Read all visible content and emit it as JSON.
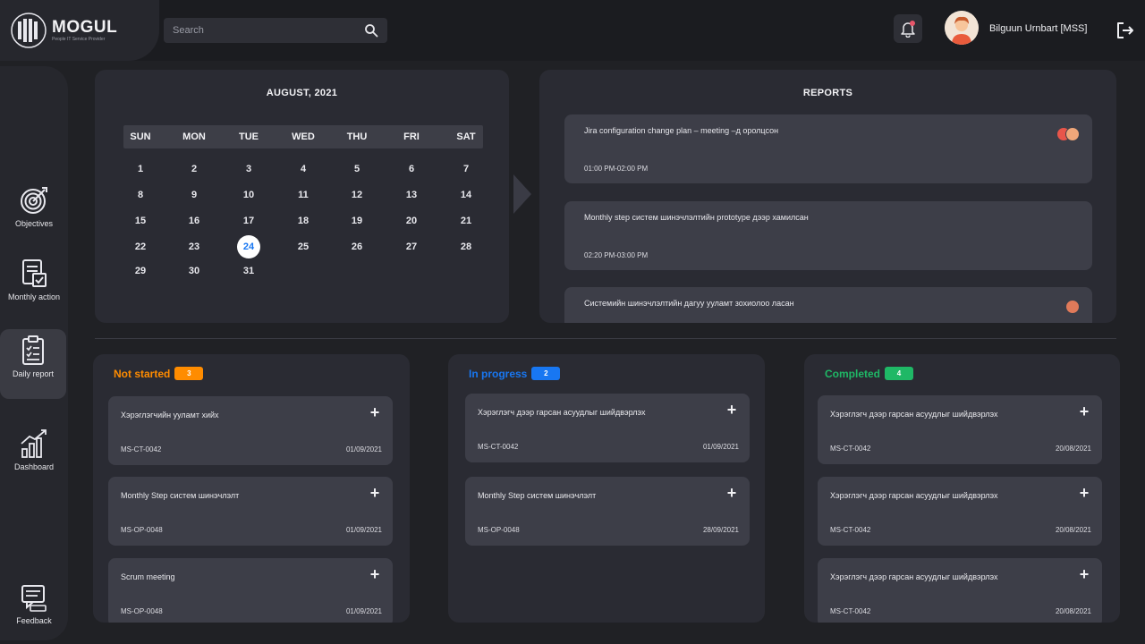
{
  "header": {
    "logo_name": "MOGUL",
    "logo_tagline": "People IT Service Provider",
    "search_placeholder": "Search",
    "user_name": "Bilguun Urnbart [MSS]"
  },
  "sidebar": {
    "items": [
      {
        "label": "Objectives",
        "icon": "target-icon"
      },
      {
        "label": "Monthly action",
        "icon": "document-icon"
      },
      {
        "label": "Daily report",
        "icon": "clipboard-icon",
        "active": true
      },
      {
        "label": "Dashboard",
        "icon": "chart-icon"
      },
      {
        "label": "Feedback",
        "icon": "feedback-icon"
      }
    ]
  },
  "calendar": {
    "title": "AUGUST, 2021",
    "weekdays": [
      "SUN",
      "MON",
      "TUE",
      "WED",
      "THU",
      "FRI",
      "SAT"
    ],
    "weeks": [
      [
        "1",
        "2",
        "3",
        "4",
        "5",
        "6",
        "7"
      ],
      [
        "8",
        "9",
        "10",
        "11",
        "12",
        "13",
        "14"
      ],
      [
        "15",
        "16",
        "17",
        "18",
        "19",
        "20",
        "21"
      ],
      [
        "22",
        "23",
        "24",
        "25",
        "26",
        "27",
        "28"
      ],
      [
        "29",
        "30",
        "31",
        "",
        "",
        "",
        ""
      ]
    ],
    "selected_day": "24"
  },
  "reports": {
    "title": "REPORTS",
    "items": [
      {
        "title": "Jira configuration change plan – meeting –д оролцсон",
        "time": "01:00 PM-02:00 PM"
      },
      {
        "title": "Monthly step систем шинэчлэлтийн prototype дээр хамилсан",
        "time": "02:20 PM-03:00 PM"
      },
      {
        "title": "Системийн шинэчлэлтийн дагуу ууламт зохиолоо ласан",
        "time": ""
      }
    ]
  },
  "kanban": {
    "columns": [
      {
        "title": "Not started",
        "count": "3",
        "color": "#ff8c00",
        "tasks": [
          {
            "title": "Хэрэглэгчийн ууламт хийх",
            "code": "MS-CT-0042",
            "date": "01/09/2021"
          },
          {
            "title": "Monthly Step систем шинэчлэлт",
            "code": "MS-OP-0048",
            "date": "01/09/2021"
          },
          {
            "title": "Scrum meeting",
            "code": "MS-OP-0048",
            "date": "01/09/2021"
          }
        ]
      },
      {
        "title": "In progress",
        "count": "2",
        "color": "#1877f2",
        "tasks": [
          {
            "title": "Хэрэглэгч дээр гарсан асуудлыг шийдвэрлэх",
            "code": "MS-CT-0042",
            "date": "01/09/2021"
          },
          {
            "title": "Monthly Step систем шинэчлэлт",
            "code": "MS-OP-0048",
            "date": "28/09/2021"
          }
        ]
      },
      {
        "title": "Completed",
        "count": "4",
        "color": "#1fb866",
        "tasks": [
          {
            "title": "Хэрэглэгч дээр гарсан асуудлыг шийдвэрлэх",
            "code": "MS-CT-0042",
            "date": "20/08/2021"
          },
          {
            "title": "Хэрэглэгч дээр гарсан асуудлыг шийдвэрлэх",
            "code": "MS-CT-0042",
            "date": "20/08/2021"
          },
          {
            "title": "Хэрэглэгч дээр гарсан асуудлыг шийдвэрлэх",
            "code": "MS-CT-0042",
            "date": "20/08/2021"
          }
        ]
      }
    ]
  }
}
